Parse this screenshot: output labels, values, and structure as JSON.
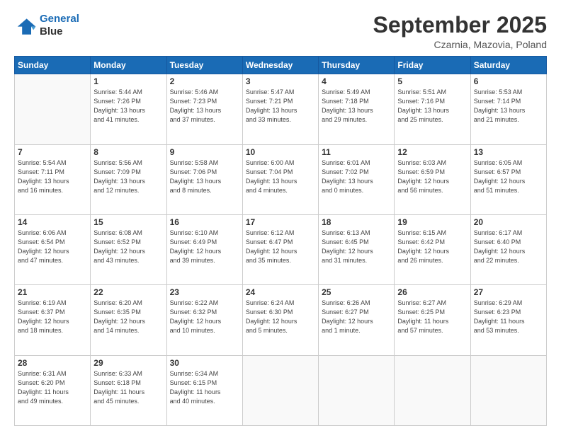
{
  "header": {
    "logo_line1": "General",
    "logo_line2": "Blue",
    "month": "September 2025",
    "location": "Czarnia, Mazovia, Poland"
  },
  "weekdays": [
    "Sunday",
    "Monday",
    "Tuesday",
    "Wednesday",
    "Thursday",
    "Friday",
    "Saturday"
  ],
  "weeks": [
    [
      {
        "day": "",
        "info": ""
      },
      {
        "day": "1",
        "info": "Sunrise: 5:44 AM\nSunset: 7:26 PM\nDaylight: 13 hours\nand 41 minutes."
      },
      {
        "day": "2",
        "info": "Sunrise: 5:46 AM\nSunset: 7:23 PM\nDaylight: 13 hours\nand 37 minutes."
      },
      {
        "day": "3",
        "info": "Sunrise: 5:47 AM\nSunset: 7:21 PM\nDaylight: 13 hours\nand 33 minutes."
      },
      {
        "day": "4",
        "info": "Sunrise: 5:49 AM\nSunset: 7:18 PM\nDaylight: 13 hours\nand 29 minutes."
      },
      {
        "day": "5",
        "info": "Sunrise: 5:51 AM\nSunset: 7:16 PM\nDaylight: 13 hours\nand 25 minutes."
      },
      {
        "day": "6",
        "info": "Sunrise: 5:53 AM\nSunset: 7:14 PM\nDaylight: 13 hours\nand 21 minutes."
      }
    ],
    [
      {
        "day": "7",
        "info": "Sunrise: 5:54 AM\nSunset: 7:11 PM\nDaylight: 13 hours\nand 16 minutes."
      },
      {
        "day": "8",
        "info": "Sunrise: 5:56 AM\nSunset: 7:09 PM\nDaylight: 13 hours\nand 12 minutes."
      },
      {
        "day": "9",
        "info": "Sunrise: 5:58 AM\nSunset: 7:06 PM\nDaylight: 13 hours\nand 8 minutes."
      },
      {
        "day": "10",
        "info": "Sunrise: 6:00 AM\nSunset: 7:04 PM\nDaylight: 13 hours\nand 4 minutes."
      },
      {
        "day": "11",
        "info": "Sunrise: 6:01 AM\nSunset: 7:02 PM\nDaylight: 13 hours\nand 0 minutes."
      },
      {
        "day": "12",
        "info": "Sunrise: 6:03 AM\nSunset: 6:59 PM\nDaylight: 12 hours\nand 56 minutes."
      },
      {
        "day": "13",
        "info": "Sunrise: 6:05 AM\nSunset: 6:57 PM\nDaylight: 12 hours\nand 51 minutes."
      }
    ],
    [
      {
        "day": "14",
        "info": "Sunrise: 6:06 AM\nSunset: 6:54 PM\nDaylight: 12 hours\nand 47 minutes."
      },
      {
        "day": "15",
        "info": "Sunrise: 6:08 AM\nSunset: 6:52 PM\nDaylight: 12 hours\nand 43 minutes."
      },
      {
        "day": "16",
        "info": "Sunrise: 6:10 AM\nSunset: 6:49 PM\nDaylight: 12 hours\nand 39 minutes."
      },
      {
        "day": "17",
        "info": "Sunrise: 6:12 AM\nSunset: 6:47 PM\nDaylight: 12 hours\nand 35 minutes."
      },
      {
        "day": "18",
        "info": "Sunrise: 6:13 AM\nSunset: 6:45 PM\nDaylight: 12 hours\nand 31 minutes."
      },
      {
        "day": "19",
        "info": "Sunrise: 6:15 AM\nSunset: 6:42 PM\nDaylight: 12 hours\nand 26 minutes."
      },
      {
        "day": "20",
        "info": "Sunrise: 6:17 AM\nSunset: 6:40 PM\nDaylight: 12 hours\nand 22 minutes."
      }
    ],
    [
      {
        "day": "21",
        "info": "Sunrise: 6:19 AM\nSunset: 6:37 PM\nDaylight: 12 hours\nand 18 minutes."
      },
      {
        "day": "22",
        "info": "Sunrise: 6:20 AM\nSunset: 6:35 PM\nDaylight: 12 hours\nand 14 minutes."
      },
      {
        "day": "23",
        "info": "Sunrise: 6:22 AM\nSunset: 6:32 PM\nDaylight: 12 hours\nand 10 minutes."
      },
      {
        "day": "24",
        "info": "Sunrise: 6:24 AM\nSunset: 6:30 PM\nDaylight: 12 hours\nand 5 minutes."
      },
      {
        "day": "25",
        "info": "Sunrise: 6:26 AM\nSunset: 6:27 PM\nDaylight: 12 hours\nand 1 minute."
      },
      {
        "day": "26",
        "info": "Sunrise: 6:27 AM\nSunset: 6:25 PM\nDaylight: 11 hours\nand 57 minutes."
      },
      {
        "day": "27",
        "info": "Sunrise: 6:29 AM\nSunset: 6:23 PM\nDaylight: 11 hours\nand 53 minutes."
      }
    ],
    [
      {
        "day": "28",
        "info": "Sunrise: 6:31 AM\nSunset: 6:20 PM\nDaylight: 11 hours\nand 49 minutes."
      },
      {
        "day": "29",
        "info": "Sunrise: 6:33 AM\nSunset: 6:18 PM\nDaylight: 11 hours\nand 45 minutes."
      },
      {
        "day": "30",
        "info": "Sunrise: 6:34 AM\nSunset: 6:15 PM\nDaylight: 11 hours\nand 40 minutes."
      },
      {
        "day": "",
        "info": ""
      },
      {
        "day": "",
        "info": ""
      },
      {
        "day": "",
        "info": ""
      },
      {
        "day": "",
        "info": ""
      }
    ]
  ]
}
